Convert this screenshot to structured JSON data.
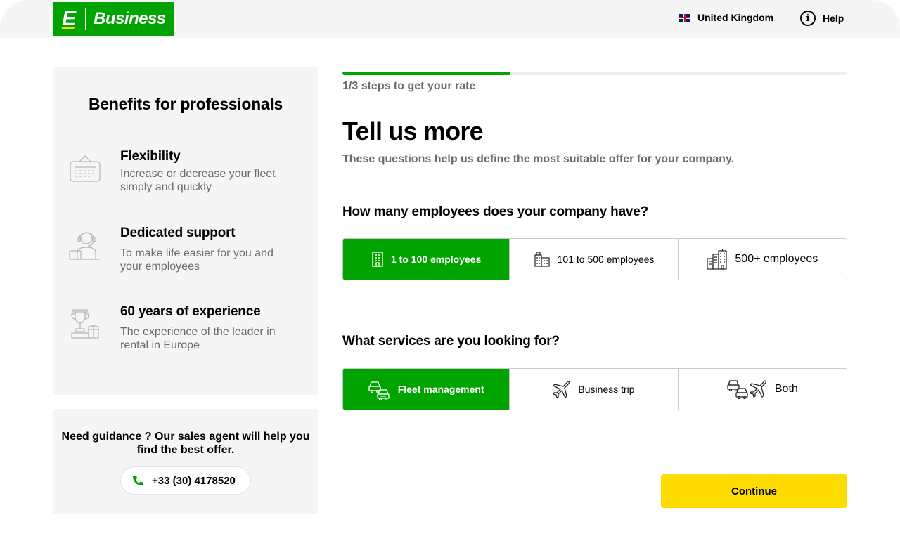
{
  "header": {
    "logo_letter": "E",
    "logo_text": "Business",
    "country": "United Kingdom",
    "help": "Help"
  },
  "benefits": {
    "title": "Benefits for professionals",
    "items": [
      {
        "icon": "calendar-sign-icon",
        "title": "Flexibility",
        "description": "Increase or decrease your fleet simply and quickly"
      },
      {
        "icon": "support-agent-icon",
        "title": "Dedicated support",
        "description": "To make life easier for you and your employees"
      },
      {
        "icon": "trophy-icon",
        "title": "60 years of experience",
        "description": "The experience of the leader in rental in Europe"
      }
    ]
  },
  "guidance": {
    "text": "Need guidance ? Our sales agent will help you find the best offer.",
    "phone": "+33 (30) 4178520"
  },
  "progress": {
    "fraction": 0.333,
    "label": "1/3 steps to get your rate"
  },
  "main": {
    "title": "Tell us more",
    "subtitle": "These questions help us define the most suitable offer for your company."
  },
  "employees": {
    "question": "How many employees does your company have?",
    "options": [
      {
        "label": "1 to 100 employees",
        "icon": "small-building-icon",
        "selected": true
      },
      {
        "label": "101 to 500 employees",
        "icon": "medium-building-icon",
        "selected": false
      },
      {
        "label": "500+ employees",
        "icon": "large-buildings-icon",
        "selected": false
      }
    ]
  },
  "services": {
    "question": "What services are you looking for?",
    "options": [
      {
        "label": "Fleet management",
        "icon": "cars-icon",
        "selected": true
      },
      {
        "label": "Business trip",
        "icon": "plane-icon",
        "selected": false
      },
      {
        "label": "Both",
        "icon": "cars-and-plane-icon",
        "selected": false
      }
    ]
  },
  "continue_label": "Continue",
  "colors": {
    "brand_green": "#00a300",
    "cta_yellow": "#ffdc00",
    "panel_bg": "#f5f5f5"
  }
}
